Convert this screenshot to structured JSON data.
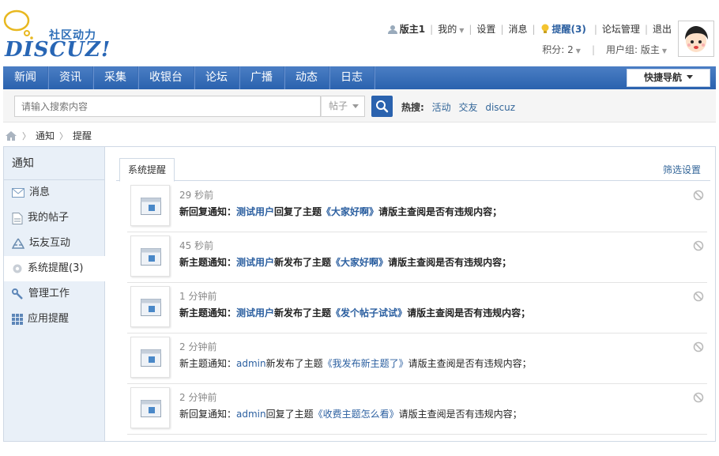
{
  "logo": {
    "cn": "社区动力",
    "en": "DISCUZ!"
  },
  "userbar": {
    "user": "版主1",
    "mine": "我的",
    "settings": "设置",
    "messages": "消息",
    "remind": "提醒(3)",
    "forum_admin": "论坛管理",
    "logout": "退出",
    "points_label": "积分: 2",
    "group_label": "用户组: 版主"
  },
  "nav": {
    "items": [
      "新闻",
      "资讯",
      "采集",
      "收银台",
      "论坛",
      "广播",
      "动态",
      "日志"
    ],
    "quicknav": "快捷导航"
  },
  "search": {
    "placeholder": "请输入搜索内容",
    "type": "帖子",
    "hot_label": "热搜:",
    "hot": [
      "活动",
      "交友",
      "discuz"
    ]
  },
  "breadcrumb": [
    "通知",
    "提醒"
  ],
  "sidebar": {
    "title": "通知",
    "items": [
      {
        "label": "消息",
        "icon": "envelope-icon"
      },
      {
        "label": "我的帖子",
        "icon": "document-icon"
      },
      {
        "label": "坛友互动",
        "icon": "recycle-icon"
      },
      {
        "label": "系统提醒(3)",
        "icon": "gear-icon"
      },
      {
        "label": "管理工作",
        "icon": "wrench-icon"
      },
      {
        "label": "应用提醒",
        "icon": "grid-icon"
      }
    ]
  },
  "content": {
    "tab": "系统提醒",
    "filter": "筛选设置",
    "notices": [
      {
        "time": "29 秒前",
        "prefix": "新回复通知：",
        "user": "测试用户",
        "action": "回复了主题",
        "topic": "《大家好啊》",
        "suffix": "请版主查阅是否有违规内容；",
        "unread": true
      },
      {
        "time": "45 秒前",
        "prefix": "新主题通知：",
        "user": "测试用户",
        "action": "新发布了主题",
        "topic": "《大家好啊》",
        "suffix": "请版主查阅是否有违规内容；",
        "unread": true
      },
      {
        "time": "1 分钟前",
        "prefix": "新主题通知：",
        "user": "测试用户",
        "action": "新发布了主题",
        "topic": "《发个帖子试试》",
        "suffix": "请版主查阅是否有违规内容；",
        "unread": true
      },
      {
        "time": "2 分钟前",
        "prefix": "新主题通知：",
        "user": "admin",
        "action": "新发布了主题",
        "topic": "《我发布新主题了》",
        "suffix": "请版主查阅是否有违规内容；",
        "unread": false
      },
      {
        "time": "2 分钟前",
        "prefix": "新回复通知：",
        "user": "admin",
        "action": "回复了主题",
        "topic": "《收费主题怎么看》",
        "suffix": "请版主查阅是否有违规内容；",
        "unread": false
      }
    ]
  }
}
